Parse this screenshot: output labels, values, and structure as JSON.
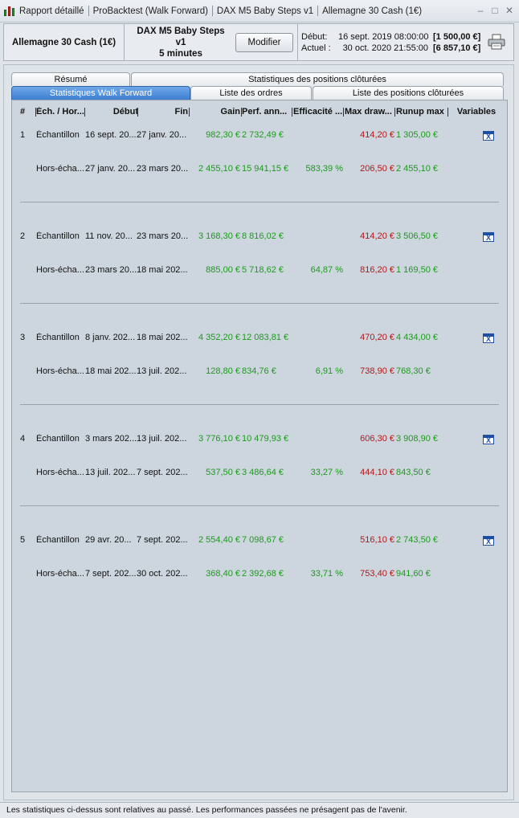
{
  "titlebar": {
    "segments": [
      "Rapport détaillé",
      "ProBacktest (Walk Forward)",
      "DAX M5 Baby Steps v1",
      "Allemagne 30 Cash (1€)"
    ],
    "controls": [
      "–",
      "□",
      "✕"
    ]
  },
  "header": {
    "instrument": "Allemagne 30 Cash (1€)",
    "strategy_name": "DAX M5 Baby Steps v1",
    "timeframe": "5 minutes",
    "modify_label": "Modifier",
    "start_label": "Début:",
    "start_date": "16 sept. 2019 08:00:00",
    "start_capital": "[1 500,00 €]",
    "current_label": "Actuel :",
    "current_date": "30 oct. 2020 21:55:00",
    "current_capital": "[6 857,10 €]"
  },
  "tabs": {
    "row1": [
      "Résumé",
      "Statistiques des positions clôturées"
    ],
    "row2": [
      "Statistiques Walk Forward",
      "Liste des ordres",
      "Liste des positions clôturées"
    ],
    "active": "Statistiques Walk Forward"
  },
  "table": {
    "columns": [
      "#",
      "Éch. / Hor...",
      "Début",
      "Fin",
      "Gain",
      "Perf. ann...",
      "Efficacité ...",
      "Max draw...",
      "Runup max",
      "Variables"
    ],
    "groups": [
      {
        "num": "1",
        "sample": {
          "type": "Échantillon",
          "start": "16 sept. 20...",
          "end": "27 janv. 20...",
          "gain": "982,30 €",
          "perf": "2 732,49 €",
          "eff": "",
          "maxdd": "414,20 €",
          "runup": "1 305,00 €"
        },
        "oos": {
          "type": "Hors-écha...",
          "start": "27 janv. 20...",
          "end": "23 mars 20...",
          "gain": "2 455,10 €",
          "perf": "15 941,15 €",
          "eff": "583,39 %",
          "maxdd": "206,50 €",
          "runup": "2 455,10 €"
        }
      },
      {
        "num": "2",
        "sample": {
          "type": "Échantillon",
          "start": "11 nov. 20...",
          "end": "23 mars 20...",
          "gain": "3 168,30 €",
          "perf": "8 816,02 €",
          "eff": "",
          "maxdd": "414,20 €",
          "runup": "3 506,50 €"
        },
        "oos": {
          "type": "Hors-écha...",
          "start": "23 mars 20...",
          "end": "18 mai 202...",
          "gain": "885,00 €",
          "perf": "5 718,62 €",
          "eff": "64,87 %",
          "maxdd": "816,20 €",
          "runup": "1 169,50 €"
        }
      },
      {
        "num": "3",
        "sample": {
          "type": "Échantillon",
          "start": "8 janv. 202...",
          "end": "18 mai 202...",
          "gain": "4 352,20 €",
          "perf": "12 083,81 €",
          "eff": "",
          "maxdd": "470,20 €",
          "runup": "4 434,00 €"
        },
        "oos": {
          "type": "Hors-écha...",
          "start": "18 mai 202...",
          "end": "13 juil. 202...",
          "gain": "128,80 €",
          "perf": "834,76 €",
          "eff": "6,91 %",
          "maxdd": "738,90 €",
          "runup": "768,30 €"
        }
      },
      {
        "num": "4",
        "sample": {
          "type": "Échantillon",
          "start": "3 mars 202...",
          "end": "13 juil. 202...",
          "gain": "3 776,10 €",
          "perf": "10 479,93 €",
          "eff": "",
          "maxdd": "606,30 €",
          "runup": "3 908,90 €"
        },
        "oos": {
          "type": "Hors-écha...",
          "start": "13 juil. 202...",
          "end": "7 sept. 202...",
          "gain": "537,50 €",
          "perf": "3 486,64 €",
          "eff": "33,27 %",
          "maxdd": "444,10 €",
          "runup": "843,50 €"
        }
      },
      {
        "num": "5",
        "sample": {
          "type": "Échantillon",
          "start": "29 avr. 20...",
          "end": "7 sept. 202...",
          "gain": "2 554,40 €",
          "perf": "7 098,67 €",
          "eff": "",
          "maxdd": "516,10 €",
          "runup": "2 743,50 €"
        },
        "oos": {
          "type": "Hors-écha...",
          "start": "7 sept. 202...",
          "end": "30 oct. 202...",
          "gain": "368,40 €",
          "perf": "2 392,68 €",
          "eff": "33,71 %",
          "maxdd": "753,40 €",
          "runup": "941,60 €"
        }
      }
    ]
  },
  "icons": {
    "variables": "excel-export-icon",
    "printer": "printer-icon",
    "app": "candlestick-chart-icon"
  },
  "colors": {
    "gain": "#1c9a1c",
    "drawdown": "#b01818",
    "active_tab": "#4a8ad9"
  },
  "status_text": "Les statistiques ci-dessus sont relatives au passé. Les performances passées ne présagent pas de l'avenir."
}
